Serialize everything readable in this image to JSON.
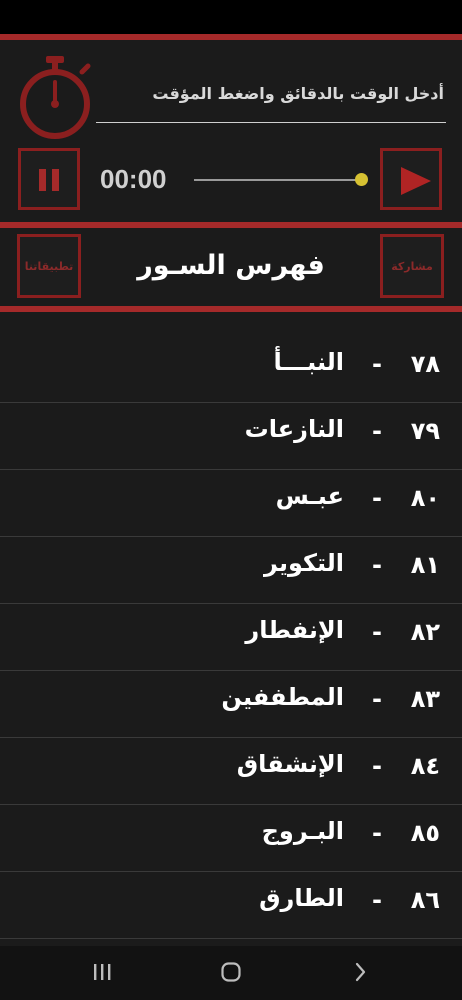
{
  "timer": {
    "prompt": "أدخل الوقت بالدقائق واضغط المؤقت",
    "time": "00:00",
    "progress": 1.0
  },
  "header": {
    "title": "فهرس السـور",
    "share_label": "مشاركة",
    "apps_label": "تطبيقاتنا"
  },
  "surahs": [
    {
      "number": "٧٨",
      "name": "النبـــأ"
    },
    {
      "number": "٧٩",
      "name": "النازعات"
    },
    {
      "number": "٨٠",
      "name": "عبـس"
    },
    {
      "number": "٨١",
      "name": "التكوير"
    },
    {
      "number": "٨٢",
      "name": "الإنفطار"
    },
    {
      "number": "٨٣",
      "name": "المطففين"
    },
    {
      "number": "٨٤",
      "name": "الإنشقاق"
    },
    {
      "number": "٨٥",
      "name": "البـروج"
    },
    {
      "number": "٨٦",
      "name": "الطارق"
    }
  ],
  "colors": {
    "accent": "#a52a2a",
    "background": "#1b1b1b",
    "slider_thumb": "#d6c132"
  },
  "icons": {
    "stopwatch": "stopwatch-icon",
    "pause": "pause-icon",
    "play": "play-icon",
    "nav_recents": "recents-icon",
    "nav_home": "home-icon",
    "nav_back": "back-icon"
  }
}
